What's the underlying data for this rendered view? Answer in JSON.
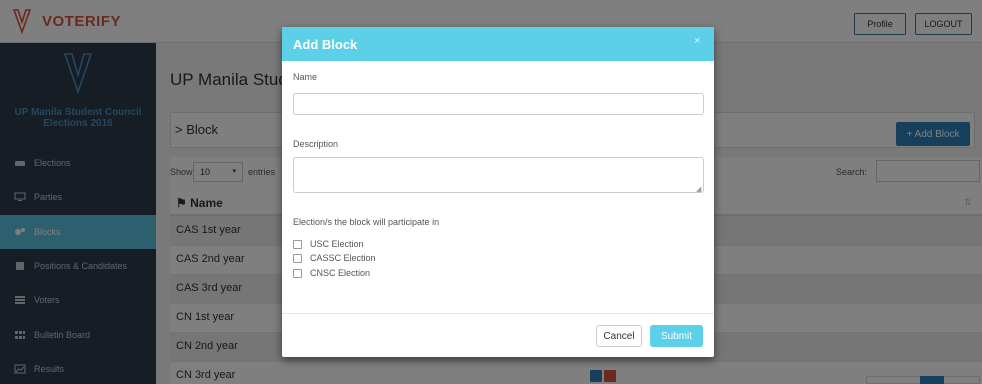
{
  "header": {
    "brand": "VOTERIFY",
    "profile_label": "Profile",
    "logout_label": "LOGOUT"
  },
  "sidebar": {
    "org_title": "UP Manila Student Council Elections 2016",
    "items": [
      {
        "label": "Elections",
        "icon": "cars-icon"
      },
      {
        "label": "Parties",
        "icon": "monitor-icon"
      },
      {
        "label": "Blocks",
        "icon": "cogs-icon",
        "active": true
      },
      {
        "label": "Positions & Candidates",
        "icon": "book-icon"
      },
      {
        "label": "Voters",
        "icon": "list-icon"
      },
      {
        "label": "Bulletin Board",
        "icon": "grid-icon"
      },
      {
        "label": "Results",
        "icon": "chart-icon"
      }
    ]
  },
  "main": {
    "page_title": "UP Manila Stud",
    "section_title": "> Block",
    "add_block_label": "+ Add Block",
    "show_label": "Show",
    "entries_value": "10",
    "entries_label": "entries",
    "search_label": "Search:",
    "column_name": "Name",
    "rows": [
      "CAS 1st year",
      "CAS 2nd year",
      "CAS 3rd year",
      "CN 1st year",
      "CN 2nd year",
      "CN 3rd year"
    ]
  },
  "modal": {
    "title": "Add Block",
    "close": "×",
    "name_label": "Name",
    "name_value": "",
    "description_label": "Description",
    "description_value": "",
    "election_label": "Election/s the block will participate in",
    "elections": [
      "USC Election",
      "CASSC Election",
      "CNSC Election"
    ],
    "cancel_label": "Cancel",
    "submit_label": "Submit"
  },
  "colors": {
    "accent": "#5bd0e8",
    "brand": "#d9533c",
    "primary_button": "#2c7fb8",
    "sidebar_bg": "#2c3a4a"
  }
}
